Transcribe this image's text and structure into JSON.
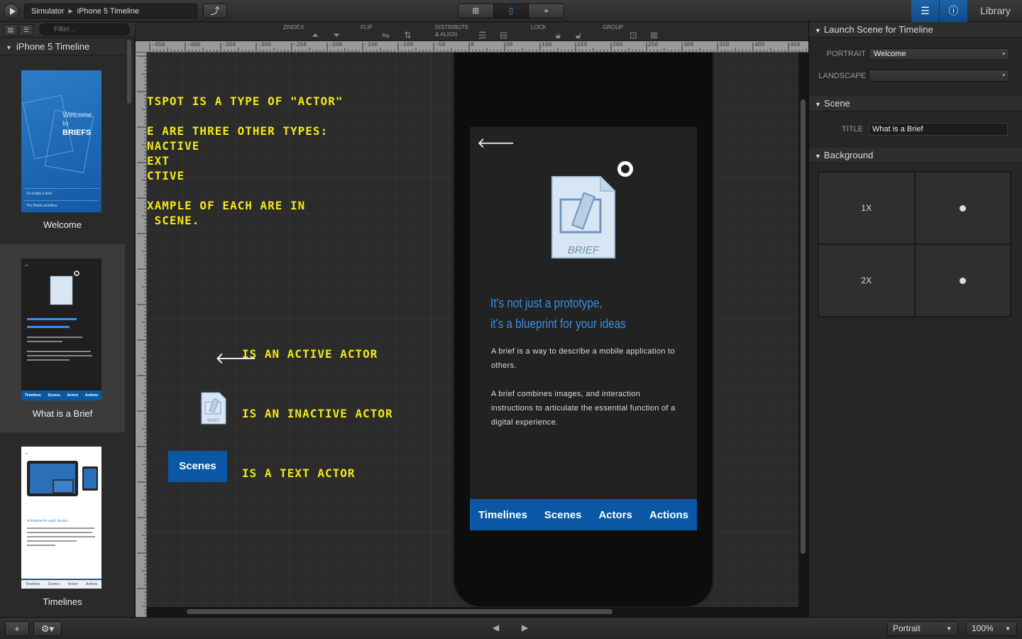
{
  "topbar": {
    "breadcrumb": [
      "Simulator",
      "iPhone 5 Timeline"
    ],
    "library_label": "Library"
  },
  "left_panel": {
    "filter_placeholder": "Filter...",
    "timeline_title": "iPhone 5 Timeline",
    "scenes": [
      {
        "name": "Welcome",
        "selected": false
      },
      {
        "name": "What is a Brief",
        "selected": true
      },
      {
        "name": "Timelines",
        "selected": false
      }
    ],
    "thumb_welcome": {
      "line1": "Welcome",
      "line2": "to",
      "line3": "BRIEFS",
      "row1": "Go inside a brief",
      "row2": "The Briefs workflow"
    },
    "thumb_brief_tabs": [
      "Timelines",
      "Scenes",
      "Actors",
      "Actions"
    ],
    "thumb_timelines": {
      "heading": "A timeline for each device",
      "tabs": [
        "Timelines",
        "Scenes",
        "Actors",
        "Actions"
      ]
    }
  },
  "canvas_toolbar": {
    "zindex": "ZINDEX",
    "flip": "FLIP",
    "distribute_1": "DISTRIBUTE",
    "distribute_2": "& ALIGN",
    "lock": "LOCK",
    "group": "GROUP"
  },
  "ruler": {
    "h_labels": [
      "-450",
      "-400",
      "-350",
      "-300",
      "-250",
      "-200",
      "-150",
      "-100",
      "-50",
      "0",
      "50",
      "100",
      "150",
      "200",
      "250",
      "300",
      "350",
      "400",
      "450"
    ]
  },
  "canvas": {
    "note_1": "TSPOT IS A TYPE OF \"ACTOR\"",
    "note_2": "E ARE THREE OTHER TYPES:\nNACTIVE\nEXT\nCTIVE",
    "note_3": "XAMPLE OF EACH ARE IN\n SCENE.",
    "legend_active": "IS AN ACTIVE ACTOR",
    "legend_inactive": "IS AN INACTIVE ACTOR",
    "legend_text": "IS A TEXT ACTOR",
    "text_actor_label": "Scenes",
    "doc_label": "BRIEF"
  },
  "screen": {
    "doc_label": "BRIEF",
    "tagline_1": "It's not just a prototype,",
    "tagline_2": "it's a blueprint for your ideas",
    "para_1": "A brief is a way to describe a mobile application to others.",
    "para_2": "A brief combines images, and interaction instructions to articulate the essential function of a digital experience.",
    "tabs": [
      "Timelines",
      "Scenes",
      "Actors",
      "Actions"
    ],
    "accent": "#0a58a5",
    "tagline_color": "#3b8ee0"
  },
  "right_panel": {
    "launch_header": "Launch Scene for Timeline",
    "portrait_label": "PORTRAIT",
    "portrait_value": "Welcome",
    "landscape_label": "LANDSCAPE",
    "landscape_value": "",
    "scene_header": "Scene",
    "title_label": "TITLE",
    "title_value": "What is a Brief",
    "background_header": "Background",
    "bg_1x": "1X",
    "bg_2x": "2X"
  },
  "bottombar": {
    "orientation": "Portrait",
    "zoom": "100%"
  }
}
